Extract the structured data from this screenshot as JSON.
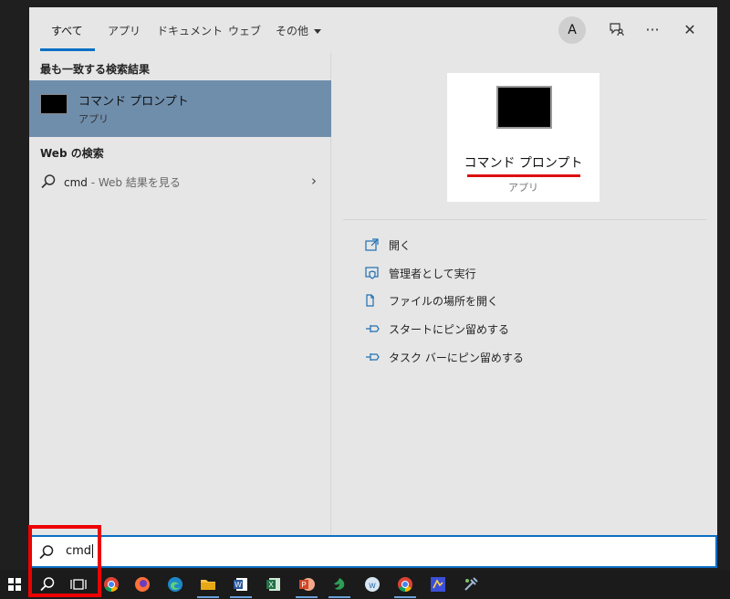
{
  "tabs": [
    {
      "label": "すべて",
      "active": true
    },
    {
      "label": "アプリ"
    },
    {
      "label": "ドキュメント"
    },
    {
      "label": "ウェブ"
    },
    {
      "label": "その他"
    }
  ],
  "header": {
    "avatar_letter": "A",
    "more_label": "···",
    "close_label": "✕"
  },
  "left": {
    "best_match_heading": "最も一致する検索結果",
    "best_match": {
      "title": "コマンド プロンプト",
      "subtitle": "アプリ"
    },
    "web_heading": "Web の検索",
    "web_item": {
      "query": "cmd",
      "suffix": " - Web 結果を見る",
      "arrow": "›"
    }
  },
  "right": {
    "card": {
      "title": "コマンド プロンプト",
      "subtitle": "アプリ"
    },
    "actions": [
      {
        "label": "開く",
        "icon": "open-icon"
      },
      {
        "label": "管理者として実行",
        "icon": "shield-admin-icon"
      },
      {
        "label": "ファイルの場所を開く",
        "icon": "file-location-icon"
      },
      {
        "label": "スタートにピン留めする",
        "icon": "pin-icon"
      },
      {
        "label": "タスク バーにピン留めする",
        "icon": "pin-icon"
      }
    ]
  },
  "search": {
    "value": "cmd"
  },
  "taskbar": {
    "items": [
      "windows-start-icon",
      "search-icon",
      "task-view-icon",
      "chrome-icon",
      "firefox-icon",
      "edge-icon",
      "file-explorer-icon",
      "word-icon",
      "excel-icon",
      "powerpoint-icon",
      "app-green-icon",
      "app-w-icon",
      "chrome-alt-icon",
      "app-blue-icon",
      "app-tool-icon"
    ]
  },
  "colors": {
    "accent": "#0b6fc6",
    "highlight": "#e00000",
    "selection": "#6f8eac",
    "underline": "#d11111"
  }
}
